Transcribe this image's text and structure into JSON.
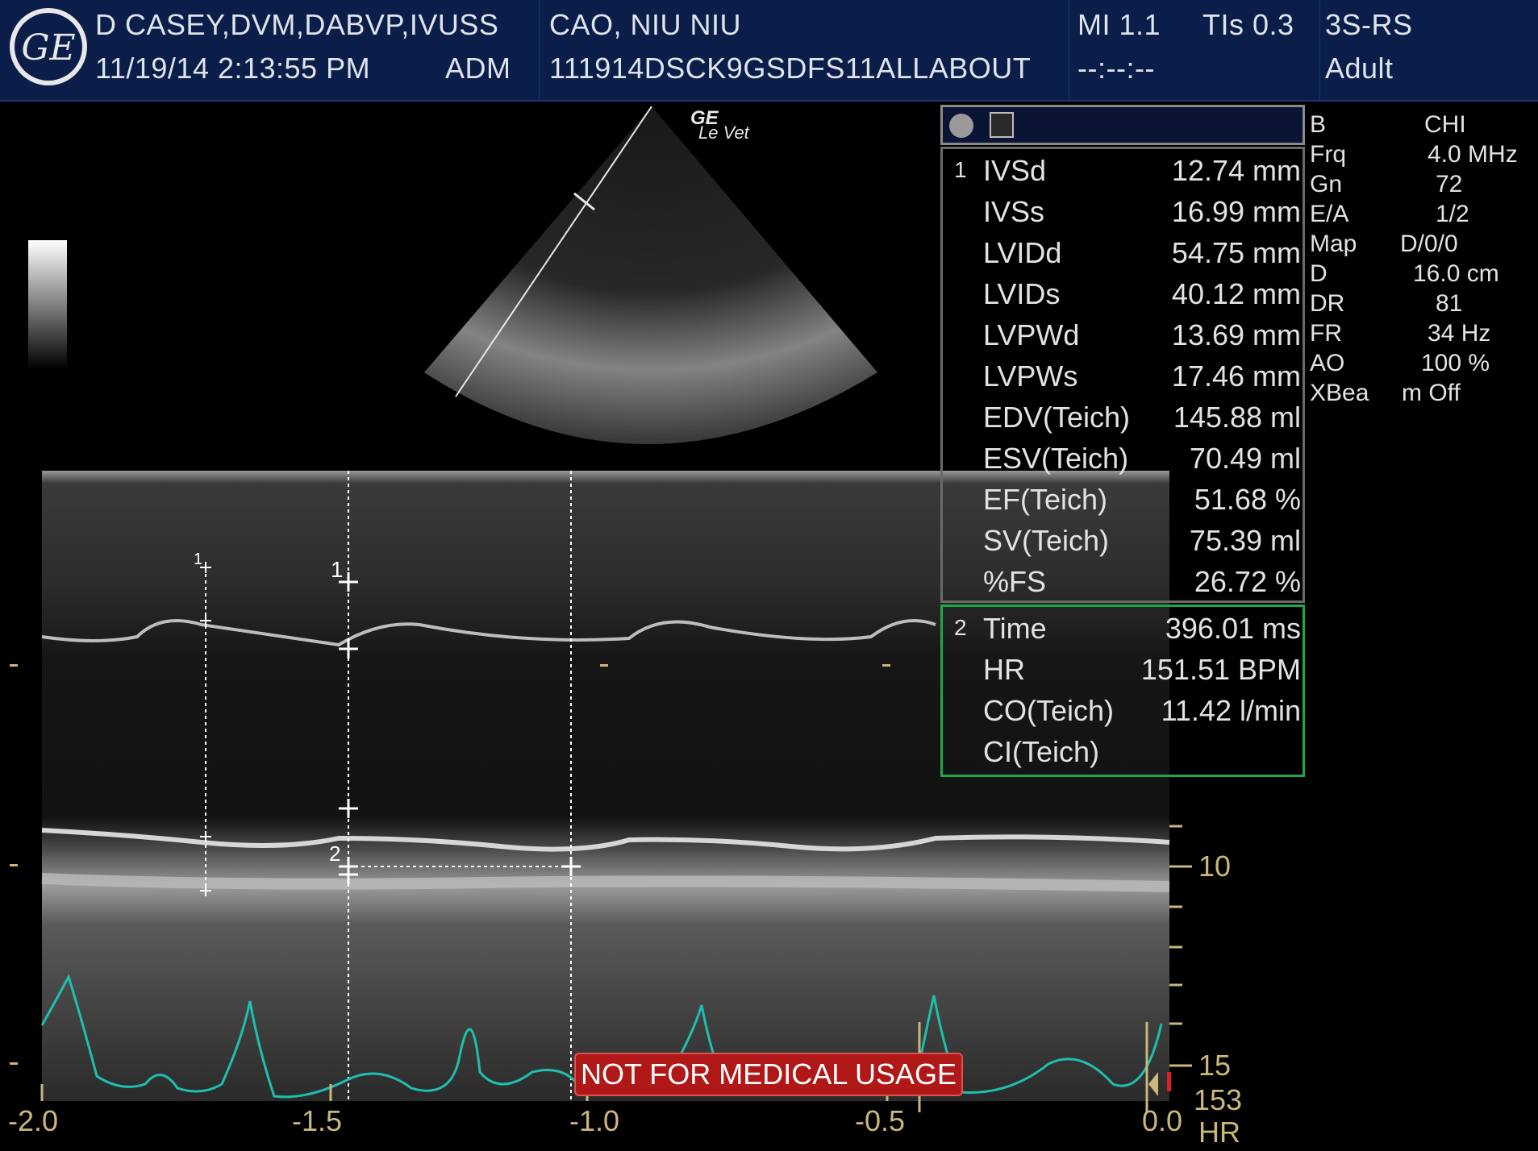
{
  "header": {
    "operator": "D CASEY,DVM,DABVP,IVUSS",
    "datetime": "11/19/14 2:13:55 PM",
    "user": "ADM",
    "patient_name": "CAO, NIU NIU",
    "patient_id": "111914DSCK9GSDFS11ALLABOUT",
    "mi": "MI 1.1",
    "tis": "TIs 0.3",
    "timer": "--:--:--",
    "probe": "3S-RS",
    "preset": "Adult"
  },
  "logo_text": "GE",
  "probe_mark": {
    "brand": "GE",
    "model": "Le Vet"
  },
  "measurements": {
    "group1_index": "1",
    "group1": [
      {
        "label": "IVSd",
        "value": "12.74 mm"
      },
      {
        "label": "IVSs",
        "value": "16.99 mm"
      },
      {
        "label": "LVIDd",
        "value": "54.75 mm"
      },
      {
        "label": "LVIDs",
        "value": "40.12 mm"
      },
      {
        "label": "LVPWd",
        "value": "13.69 mm"
      },
      {
        "label": "LVPWs",
        "value": "17.46 mm"
      },
      {
        "label": "EDV(Teich)",
        "value": "145.88 ml"
      },
      {
        "label": "ESV(Teich)",
        "value": "70.49 ml"
      },
      {
        "label": "EF(Teich)",
        "value": "51.68 %"
      },
      {
        "label": "SV(Teich)",
        "value": "75.39 ml"
      },
      {
        "label": "%FS",
        "value": "26.72 %"
      }
    ],
    "group2_index": "2",
    "group2": [
      {
        "label": "Time",
        "value": "396.01 ms"
      },
      {
        "label": "HR",
        "value": "151.51 BPM"
      },
      {
        "label": "CO(Teich)",
        "value": "11.42 l/min"
      },
      {
        "label": "CI(Teich)",
        "value": ""
      }
    ]
  },
  "params": [
    {
      "key": "B",
      "value": "CHI"
    },
    {
      "key": "Frq",
      "value": "4.0 MHz"
    },
    {
      "key": "Gn",
      "value": "72"
    },
    {
      "key": "E/A",
      "value": "1/2"
    },
    {
      "key": "Map",
      "value": "D/0/0"
    },
    {
      "key": "D",
      "value": "16.0 cm"
    },
    {
      "key": "DR",
      "value": "81"
    },
    {
      "key": "FR",
      "value": "34 Hz"
    },
    {
      "key": "AO",
      "value": "100 %"
    },
    {
      "key": "XBea",
      "value": "m Off"
    }
  ],
  "mmode_markers": {
    "caliper1": "1",
    "caliper2": "2",
    "small1": "1"
  },
  "depth_labels": {
    "d10": "10",
    "d15": "15"
  },
  "time_axis": [
    "-2.0",
    "-1.5",
    "-1.0",
    "-0.5",
    "0.0"
  ],
  "hr": {
    "value": "153",
    "label": "HR"
  },
  "warning": "NOT FOR MEDICAL USAGE",
  "colors": {
    "header_bg": "#0b1e4a",
    "ecg": "#1fbfb0",
    "green_box": "#1fa84a",
    "axis": "#c9b87a",
    "warning": "#b01818"
  }
}
